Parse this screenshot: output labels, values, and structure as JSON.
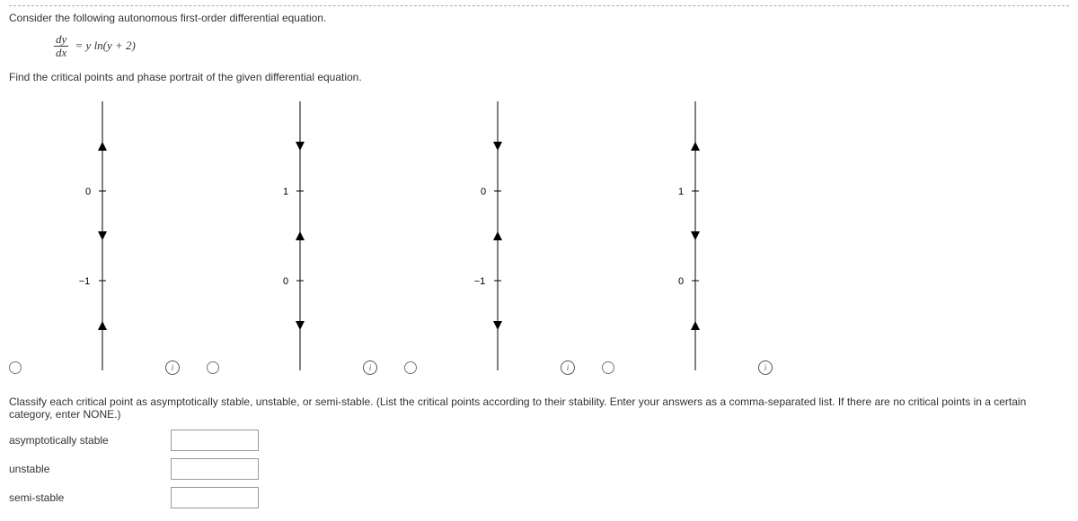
{
  "q_intro": "Consider the following autonomous first-order differential equation.",
  "eq_num": "dy",
  "eq_den": "dx",
  "eq_rhs": " = y ln(y + 2)",
  "q_find": "Find the critical points and phase portrait of the given differential equation.",
  "options": [
    {
      "top_label": "0",
      "bottom_label": "−1",
      "arrows": "A"
    },
    {
      "top_label": "1",
      "bottom_label": "0",
      "arrows": "B"
    },
    {
      "top_label": "0",
      "bottom_label": "−1",
      "arrows": "C"
    },
    {
      "top_label": "1",
      "bottom_label": "0",
      "arrows": "D"
    }
  ],
  "info_glyph": "i",
  "classify_text": "Classify each critical point as asymptotically stable, unstable, or semi-stable. (List the critical points according to their stability. Enter your answers as a comma-separated list. If there are no critical points in a certain category, enter NONE.)",
  "labels": {
    "asymp": "asymptotically stable",
    "unstable": "unstable",
    "semi": "semi-stable"
  },
  "chart_data": {
    "type": "phase-portrait",
    "title": "Phase portraits for dy/dx = y ln(y+2)",
    "options": [
      {
        "id": "A",
        "critical_points": [
          0,
          -1
        ],
        "segments": [
          {
            "region": "above 0",
            "direction": "up"
          },
          {
            "region": "between -1 and 0",
            "direction": "down"
          },
          {
            "region": "below -1",
            "direction": "up"
          }
        ]
      },
      {
        "id": "B",
        "critical_points": [
          1,
          0
        ],
        "segments": [
          {
            "region": "above 1",
            "direction": "down"
          },
          {
            "region": "between 0 and 1",
            "direction": "up"
          },
          {
            "region": "below 0",
            "direction": "down"
          }
        ]
      },
      {
        "id": "C",
        "critical_points": [
          0,
          -1
        ],
        "segments": [
          {
            "region": "above 0",
            "direction": "down"
          },
          {
            "region": "between -1 and 0",
            "direction": "up"
          },
          {
            "region": "below -1",
            "direction": "down"
          }
        ]
      },
      {
        "id": "D",
        "critical_points": [
          1,
          0
        ],
        "segments": [
          {
            "region": "above 1",
            "direction": "up"
          },
          {
            "region": "between 0 and 1",
            "direction": "down"
          },
          {
            "region": "below 0",
            "direction": "up"
          }
        ]
      }
    ]
  }
}
